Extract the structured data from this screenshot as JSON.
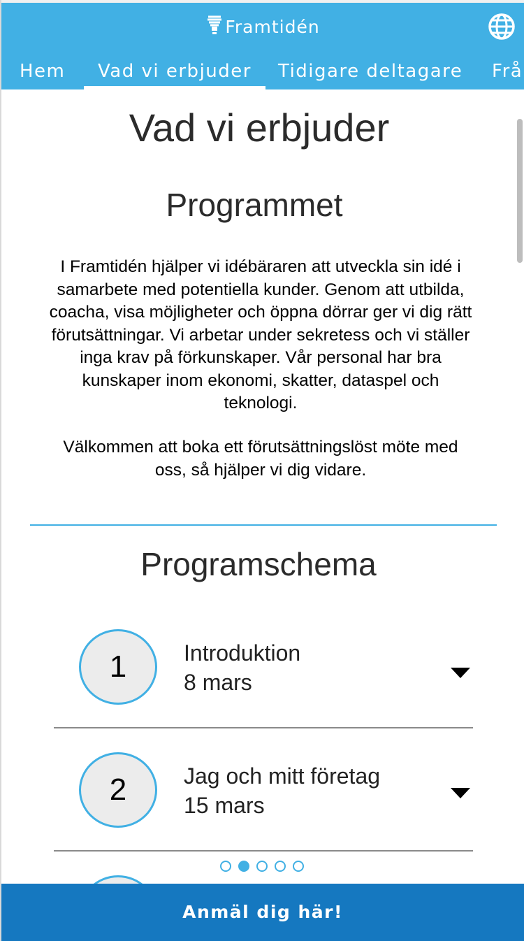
{
  "header": {
    "brand": "Framtidén",
    "logo_icon": "lightbulb-icon",
    "language_icon": "globe-icon",
    "background_color": "#41b0e4"
  },
  "nav": {
    "items": [
      {
        "label": "Hem",
        "active": false
      },
      {
        "label": "Vad vi erbjuder",
        "active": true
      },
      {
        "label": "Tidigare deltagare",
        "active": false
      },
      {
        "label": "Frå",
        "active": false
      }
    ]
  },
  "main": {
    "page_title": "Vad vi erbjuder",
    "program": {
      "heading": "Programmet",
      "paragraph1": "I Framtidén hjälper vi idébäraren att utveckla sin idé i samarbete med potentiella kunder. Genom att utbilda, coacha, visa möjligheter och öppna dörrar ger vi dig rätt förutsättningar. Vi arbetar under sekretess och vi ställer inga krav på förkunskaper. Vår personal har bra kunskaper inom ekonomi, skatter, dataspel och teknologi.",
      "paragraph2": "Välkommen att boka ett förutsättningslöst möte med oss, så hjälper vi dig vidare."
    },
    "schedule": {
      "heading": "Programschema",
      "items": [
        {
          "number": "1",
          "title": "Introduktion",
          "date": "8 mars"
        },
        {
          "number": "2",
          "title": "Jag och mitt företag",
          "date": "15 mars"
        }
      ]
    },
    "pagination": {
      "count": 5,
      "active_index": 1
    }
  },
  "cta": {
    "label": "Anmäl dig här!",
    "color": "#1578c0"
  }
}
